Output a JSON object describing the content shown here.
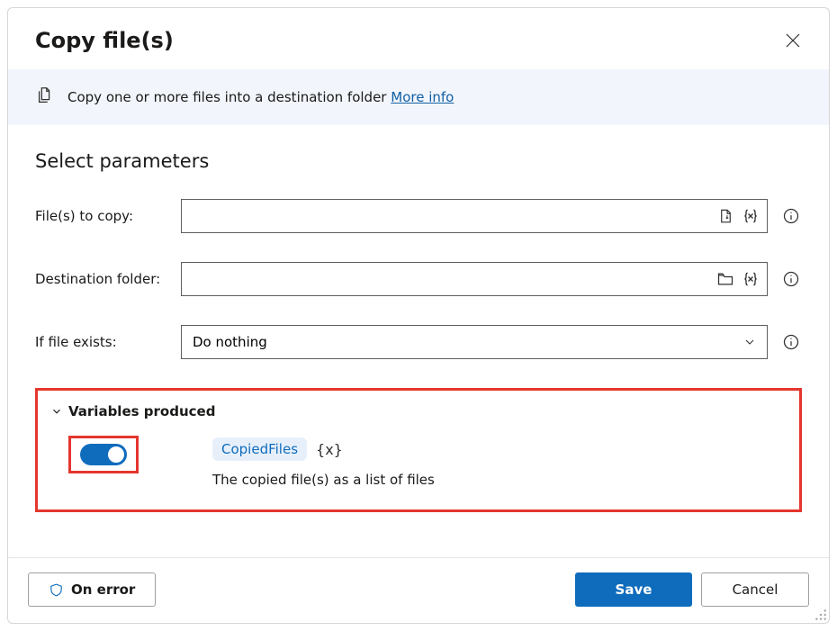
{
  "header": {
    "title": "Copy file(s)"
  },
  "banner": {
    "text": "Copy one or more files into a destination folder ",
    "link": "More info"
  },
  "section_title": "Select parameters",
  "fields": {
    "files_to_copy": {
      "label": "File(s) to copy:",
      "value": ""
    },
    "destination_folder": {
      "label": "Destination folder:",
      "value": ""
    },
    "if_file_exists": {
      "label": "If file exists:",
      "selected": "Do nothing"
    }
  },
  "variables": {
    "heading": "Variables produced",
    "toggle_on": true,
    "name": "CopiedFiles",
    "token": "{x}",
    "description": "The copied file(s) as a list of files"
  },
  "footer": {
    "on_error": "On error",
    "save": "Save",
    "cancel": "Cancel"
  }
}
